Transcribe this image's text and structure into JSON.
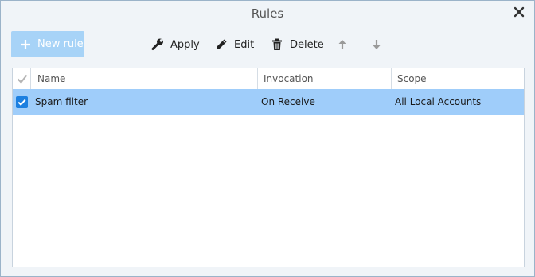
{
  "window": {
    "title": "Rules"
  },
  "toolbar": {
    "new_rule_label": "New rule",
    "apply_label": "Apply",
    "edit_label": "Edit",
    "delete_label": "Delete",
    "icons": {
      "new_rule": "plus-icon",
      "apply": "wrench-icon",
      "edit": "pencil-icon",
      "delete": "trash-icon",
      "move_up": "arrow-up-icon",
      "move_down": "arrow-down-icon"
    }
  },
  "table": {
    "columns": {
      "name": "Name",
      "invocation": "Invocation",
      "scope": "Scope"
    },
    "rows": [
      {
        "checked": true,
        "selected": true,
        "name": "Spam filter",
        "invocation": "On Receive",
        "scope": "All Local Accounts"
      }
    ]
  },
  "colors": {
    "accent": "#1b7fe0",
    "selected_row": "#9fcdfa",
    "new_rule_button": "#a7d3f7",
    "window_background": "#f0f4f8"
  }
}
